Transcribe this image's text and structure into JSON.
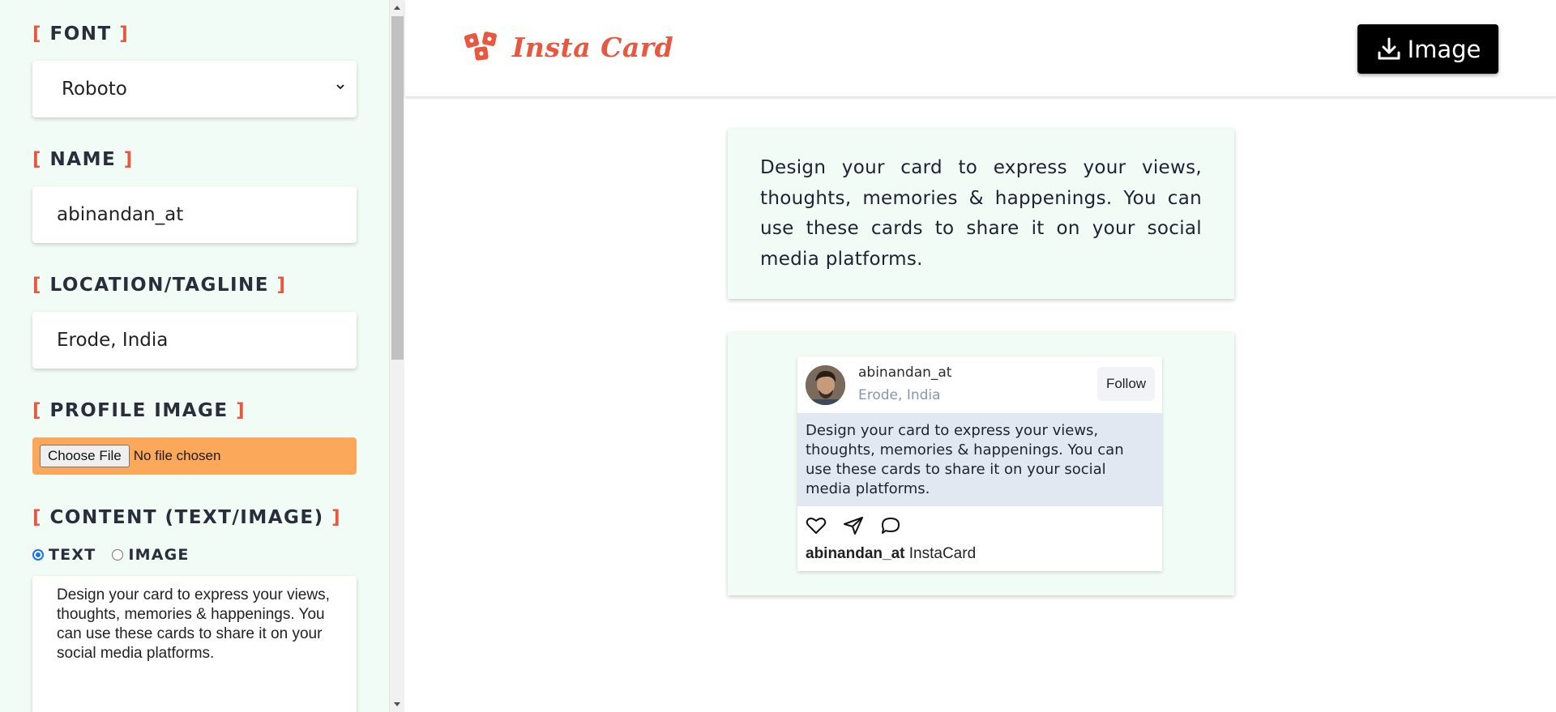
{
  "sidebar": {
    "font": {
      "label": "FONT",
      "value": "Roboto"
    },
    "name": {
      "label": "NAME",
      "value": "abinandan_at"
    },
    "location": {
      "label": "LOCATION/TAGLINE",
      "value": "Erode, India"
    },
    "profile_image": {
      "label": "PROFILE IMAGE",
      "button": "Choose File",
      "status": "No file chosen"
    },
    "content": {
      "label": "CONTENT (TEXT/IMAGE)",
      "options": [
        "TEXT",
        "IMAGE"
      ],
      "selected": "TEXT",
      "text": "Design your card to express your views, thoughts, memories & happenings. You can use these cards to share it on your social media platforms."
    }
  },
  "header": {
    "logo_text": "Insta Card",
    "download_label": "Image"
  },
  "main": {
    "description": "Design your card to express your views, thoughts, memories & happenings. You can use these cards to share it on your social media platforms.",
    "card": {
      "username": "abinandan_at",
      "location": "Erode, India",
      "follow_label": "Follow",
      "content": "Design your card to express your views, thoughts, memories & happenings. You can use these cards to share it on your social media platforms.",
      "caption_user": "abinandan_at",
      "caption_text": "InstaCard"
    }
  },
  "colors": {
    "accent": "#e8573f",
    "sidebar_bg": "#f2fcf6",
    "file_input_bg": "#fba85b",
    "card_content_bg": "#e2e8f1",
    "download_btn_bg": "#000000"
  },
  "icons": [
    "chevron-down-icon",
    "logo-icon",
    "download-icon",
    "heart-icon",
    "send-icon",
    "comment-icon"
  ]
}
